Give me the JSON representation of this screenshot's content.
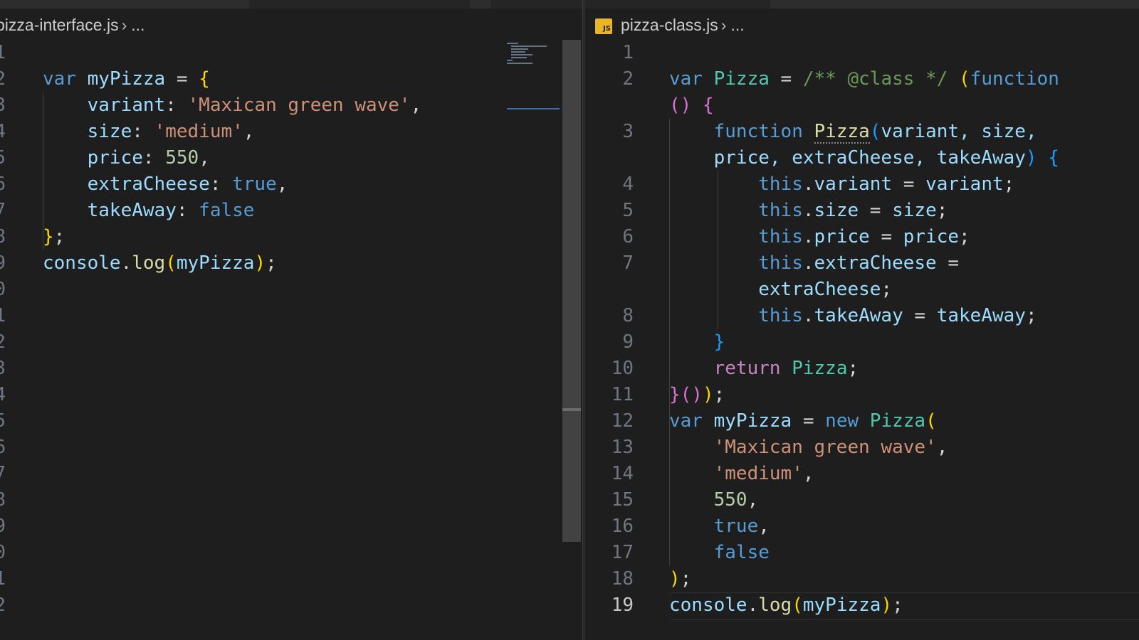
{
  "left_editor": {
    "breadcrumb": {
      "file": "pizza-interface.js",
      "rest": "..."
    },
    "line_numbers": [
      "1",
      "2",
      "3",
      "4",
      "5",
      "6",
      "7",
      "8",
      "9",
      "0",
      "1",
      "2",
      "3",
      "4",
      "5",
      "6",
      "7",
      "8",
      "9",
      "0",
      "1",
      "2"
    ],
    "code": {
      "l2": {
        "kw": "var",
        "ident": "myPizza",
        "op": " = ",
        "brace": "{"
      },
      "l3": {
        "key": "variant",
        "colon": ": ",
        "str": "'Maxican green wave'",
        "comma": ","
      },
      "l4": {
        "key": "size",
        "colon": ": ",
        "str": "'medium'",
        "comma": ","
      },
      "l5": {
        "key": "price",
        "colon": ": ",
        "num": "550",
        "comma": ","
      },
      "l6": {
        "key": "extraCheese",
        "colon": ": ",
        "bool": "true",
        "comma": ","
      },
      "l7": {
        "key": "takeAway",
        "colon": ": ",
        "bool": "false"
      },
      "l8": {
        "brace": "}",
        "semi": ";"
      },
      "l9": {
        "obj": "console",
        "dot": ".",
        "fn": "log",
        "open": "(",
        "arg": "myPizza",
        "close": ")",
        "semi": ";"
      }
    }
  },
  "right_editor": {
    "breadcrumb": {
      "icon": "JS",
      "file": "pizza-class.js",
      "rest": "..."
    },
    "line_numbers": [
      "1",
      "2",
      "",
      "3",
      "",
      "4",
      "5",
      "6",
      "7",
      "",
      "8",
      "9",
      "10",
      "11",
      "12",
      "13",
      "14",
      "15",
      "16",
      "17",
      "18",
      "19"
    ],
    "active_line": "19",
    "code": {
      "l2a": {
        "kw": "var",
        "cls": "Pizza",
        "op": " = ",
        "comment": "/** @class */",
        "open": "(",
        "fn_kw": "function"
      },
      "l2b": {
        "parens": "()",
        "brace": "{"
      },
      "l3a": {
        "fn_kw": "function",
        "cls": "Pizza",
        "open": "(",
        "params": "variant, size,",
        "comma": ""
      },
      "l3b": {
        "params": "price, extraCheese, takeAway",
        "close": ")",
        "brace": "{"
      },
      "l4": {
        "this": "this",
        "dot": ".",
        "prop": "variant",
        "op": " = ",
        "val": "variant",
        "semi": ";"
      },
      "l5": {
        "this": "this",
        "dot": ".",
        "prop": "size",
        "op": " = ",
        "val": "size",
        "semi": ";"
      },
      "l6": {
        "this": "this",
        "dot": ".",
        "prop": "price",
        "op": " = ",
        "val": "price",
        "semi": ";"
      },
      "l7a": {
        "this": "this",
        "dot": ".",
        "prop": "extraCheese",
        "op": " ="
      },
      "l7b": {
        "val": "extraCheese",
        "semi": ";"
      },
      "l8": {
        "this": "this",
        "dot": ".",
        "prop": "takeAway",
        "op": " = ",
        "val": "takeAway",
        "semi": ";"
      },
      "l9": {
        "brace": "}"
      },
      "l10": {
        "kw": "return",
        "cls": "Pizza",
        "semi": ";"
      },
      "l11": {
        "brace": "}",
        "parens": "()",
        "close": ")",
        "semi": ";"
      },
      "l12": {
        "kw": "var",
        "ident": "myPizza",
        "op": " = ",
        "new_kw": "new",
        "cls": "Pizza",
        "open": "("
      },
      "l13": {
        "str": "'Maxican green wave'",
        "comma": ","
      },
      "l14": {
        "str": "'medium'",
        "comma": ","
      },
      "l15": {
        "num": "550",
        "comma": ","
      },
      "l16": {
        "bool": "true",
        "comma": ","
      },
      "l17": {
        "bool": "false"
      },
      "l18": {
        "close": ")",
        "semi": ";"
      },
      "l19": {
        "obj": "console",
        "dot": ".",
        "fn": "log",
        "open": "(",
        "arg": "myPizza",
        "close": ")",
        "semi": ";"
      }
    }
  },
  "colors": {
    "background": "#1e1e1e",
    "keyword": "#569cd6",
    "string": "#ce9178",
    "number": "#b5cea8",
    "class": "#4ec9b0",
    "function": "#dcdcaa",
    "comment": "#6a9955"
  }
}
